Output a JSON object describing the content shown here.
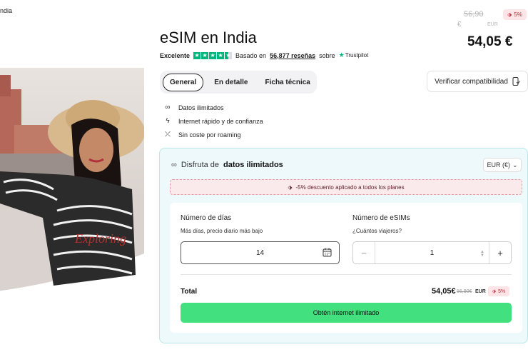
{
  "hero": {
    "caption": "ndia",
    "shirt_text": "Exploring"
  },
  "header": {
    "title": "eSIM en India",
    "rating": {
      "label": "Excelente",
      "based_on": "Basado en",
      "count_text": "56,877 reseñas",
      "on": "sobre",
      "brand": "Trustpilot",
      "stars_full": 4,
      "stars_half": 1
    },
    "price": {
      "old_value": "56,90",
      "old_symbol": "€",
      "old_code": "EUR",
      "discount": "5%",
      "current": "54,05 €"
    }
  },
  "tabs": [
    {
      "label": "General",
      "active": true
    },
    {
      "label": "En detalle",
      "active": false
    },
    {
      "label": "Ficha técnica",
      "active": false
    }
  ],
  "compat_button": "Verificar compatibilidad",
  "features": [
    {
      "icon": "infinity-icon",
      "text": "Datos ilimitados"
    },
    {
      "icon": "lightning-icon",
      "text": "Internet rápido y de confianza"
    },
    {
      "icon": "no-roaming-icon",
      "text": "Sin coste por roaming"
    }
  ],
  "panel": {
    "heading_prefix": "Disfruta de",
    "heading_bold": "datos ilimitados",
    "currency": "EUR (€)",
    "promo": "-5% descuento aplicado a todos los planes",
    "days": {
      "label": "Número de días",
      "sub": "Más días, precio diario más bajo",
      "value": "14"
    },
    "esims": {
      "label": "Número de eSIMs",
      "sub": "¿Cuántos viajeros?",
      "value": "1"
    },
    "total": {
      "label": "Total",
      "price": "54,05€",
      "old": "56,90€",
      "code": "EUR",
      "discount": "5%"
    },
    "cta": "Obtén internet ilimitado"
  },
  "colors": {
    "accent_green": "#42e07e",
    "trustpilot_green": "#00b67a",
    "panel_bg": "#eef9fb",
    "discount_red": "#c0303d"
  }
}
